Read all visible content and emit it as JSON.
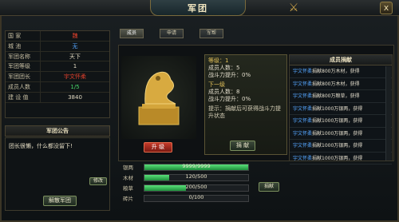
{
  "window": {
    "title": "军团",
    "close": "x"
  },
  "tabs": [
    "成员",
    "申请",
    "军帮"
  ],
  "info": [
    {
      "k": "国  家",
      "v": "魏",
      "c": "red"
    },
    {
      "k": "城  池",
      "v": "无",
      "c": "blue"
    },
    {
      "k": "军团名称",
      "v": "天下",
      "c": ""
    },
    {
      "k": "军团等级",
      "v": "1",
      "c": ""
    },
    {
      "k": "军团团长",
      "v": "宇文怀柔",
      "c": "red"
    },
    {
      "k": "成员人数",
      "v": "1/5",
      "c": "green"
    },
    {
      "k": "建 设 值",
      "v": "3840",
      "c": ""
    }
  ],
  "notice": {
    "title": "军团公告",
    "text": "团长很懒，什么都没留下!",
    "edit": "修改",
    "disband": "解散军团"
  },
  "seal": {
    "upgrade": "升 级"
  },
  "attrs": {
    "lv1": "等级：1",
    "members1": "成员人数：5",
    "power1": "战斗力提升：0%",
    "lv2": "下一级",
    "members2": "成员人数：8",
    "power2": "战斗力提升：0%",
    "tip": "提示：捐献后可获得战斗力提升状态",
    "donate_btn": "捐 献"
  },
  "donate": {
    "title": "成员捐献",
    "rows": [
      {
        "n": "宇文怀柔",
        "t": "捐献800万木材，获得"
      },
      {
        "n": "宇文怀柔",
        "t": "捐献800万木材，获得"
      },
      {
        "n": "宇文怀柔",
        "t": "捐献800万粮草，获得"
      },
      {
        "n": "宇文怀柔",
        "t": "捐献1000万银两，获得"
      },
      {
        "n": "宇文怀柔",
        "t": "捐献1000万银两，获得"
      },
      {
        "n": "宇文怀柔",
        "t": "捐献1000万银两，获得"
      },
      {
        "n": "宇文怀柔",
        "t": "捐献1000万银两，获得"
      },
      {
        "n": "宇文怀柔",
        "t": "捐献1000万银两，获得"
      }
    ]
  },
  "resources": [
    {
      "k": "银两",
      "v": "9999/9999",
      "pct": 1.0
    },
    {
      "k": "木材",
      "v": "120/500",
      "pct": 0.24
    },
    {
      "k": "粮草",
      "v": "200/500",
      "pct": 0.4
    },
    {
      "k": "砖片",
      "v": "0/100",
      "pct": 0
    }
  ],
  "donate_btn2": "捐献"
}
